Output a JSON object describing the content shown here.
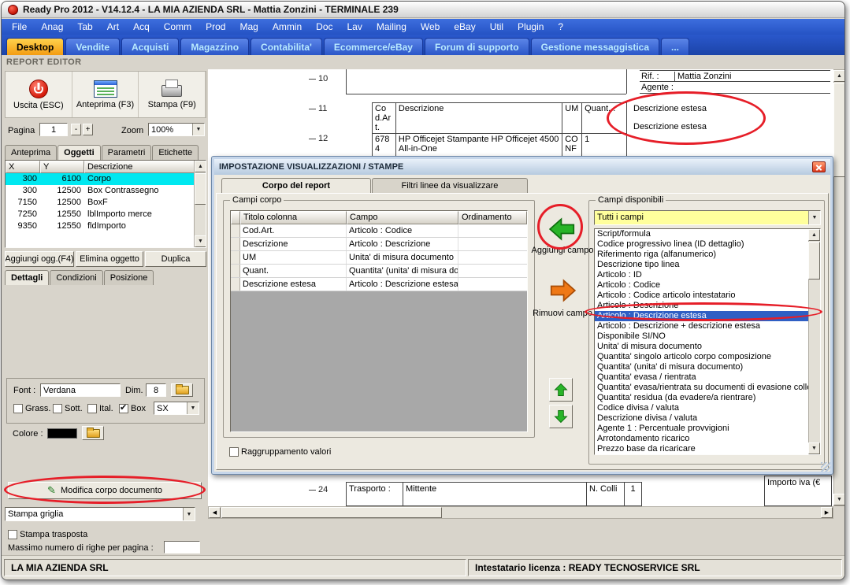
{
  "window": {
    "title": "Ready Pro 2012 - V14.12.4 - LA MIA AZIENDA SRL - Mattia Zonzini - TERMINALE 239"
  },
  "menu": {
    "items": [
      "File",
      "Anag",
      "Tab",
      "Art",
      "Acq",
      "Comm",
      "Prod",
      "Mag",
      "Ammin",
      "Doc",
      "Lav",
      "Mailing",
      "Web",
      "eBay",
      "Util",
      "Plugin",
      "?"
    ]
  },
  "main_tabs": [
    {
      "label": "Desktop",
      "active": true
    },
    {
      "label": "Vendite",
      "active": false
    },
    {
      "label": "Acquisti",
      "active": false
    },
    {
      "label": "Magazzino",
      "active": false
    },
    {
      "label": "Contabilita'",
      "active": false
    },
    {
      "label": "Ecommerce/eBay",
      "active": false
    },
    {
      "label": "Forum di supporto",
      "active": false
    },
    {
      "label": "Gestione messaggistica",
      "active": false
    },
    {
      "label": "...",
      "active": false
    }
  ],
  "report_editor": {
    "label": "REPORT EDITOR",
    "toolbar": {
      "uscita": "Uscita (ESC)",
      "anteprima": "Anteprima (F3)",
      "stampa": "Stampa (F9)"
    },
    "page": {
      "pagina_label": "Pagina",
      "value": "1",
      "minus": "-",
      "plus": "+",
      "zoom_label": "Zoom",
      "zoom_value": "100%"
    },
    "tabs": [
      "Anteprima",
      "Oggetti",
      "Parametri",
      "Etichette"
    ],
    "active_tab": "Oggetti",
    "object_table": {
      "headers": [
        "X",
        "Y",
        "Descrizione"
      ],
      "rows": [
        {
          "x": "300",
          "y": "6100",
          "desc": "Corpo",
          "selected": true
        },
        {
          "x": "300",
          "y": "12500",
          "desc": "Box Contrassegno",
          "selected": false
        },
        {
          "x": "7150",
          "y": "12500",
          "desc": "BoxF",
          "selected": false
        },
        {
          "x": "7250",
          "y": "12550",
          "desc": "lblImporto merce",
          "selected": false
        },
        {
          "x": "9350",
          "y": "12550",
          "desc": "fldImporto",
          "selected": false
        }
      ]
    },
    "object_buttons": [
      "Aggiungi ogg.(F4)",
      "Elimina oggetto",
      "Duplica"
    ],
    "detail_tabs": [
      "Dettagli",
      "Condizioni",
      "Posizione"
    ],
    "active_detail_tab": "Dettagli",
    "font": {
      "font_label": "Font :",
      "font_value": "Verdana",
      "dim_label": "Dim.",
      "dim_value": "8",
      "checkboxes": [
        {
          "label": "Grass.",
          "checked": false
        },
        {
          "label": "Sott.",
          "checked": false
        },
        {
          "label": "Ital.",
          "checked": false
        },
        {
          "label": "Box",
          "checked": true
        }
      ],
      "align_value": "SX",
      "colore_label": "Colore :"
    },
    "modifica_button": "Modifica corpo documento",
    "griglia_value": "Stampa griglia",
    "trasposta_label": "Stampa trasposta",
    "max_righe_label": "Massimo numero di righe per pagina :"
  },
  "preview": {
    "ruler": [
      "10",
      "11",
      "12"
    ],
    "ruler_bottom": "24",
    "rif_label": "Rif. :",
    "rif_value": "Mattia Zonzini",
    "agente_label": "Agente :",
    "table": {
      "headers": [
        "Cod.Art.",
        "Descrizione",
        "UM",
        "Quant..."
      ],
      "row": {
        "codice": "6784",
        "descrizione": "HP Officejet Stampante HP Officejet 4500 All-in-One",
        "um": "CONF",
        "quantita": "1"
      }
    },
    "descrizione_estesa": [
      "Descrizione estesa",
      "Descrizione estesa"
    ],
    "bottom": {
      "trasporto": "Trasporto :",
      "mittente": "Mittente",
      "colli_label": "N. Colli",
      "colli_value": "1",
      "importo": "Importo iva (€"
    }
  },
  "dialog": {
    "title": "IMPOSTAZIONE VISUALIZZAZIONI / STAMPE",
    "tabs": [
      "Corpo del report",
      "Filtri linee da visualizzare"
    ],
    "active_tab": "Corpo del report",
    "campi_corpo": {
      "label": "Campi corpo",
      "headers": [
        "Titolo colonna",
        "Campo",
        "Ordinamento"
      ],
      "rows": [
        {
          "titolo": "Cod.Art.",
          "campo": "Articolo : Codice",
          "ordinamento": ""
        },
        {
          "titolo": "Descrizione",
          "campo": "Articolo : Descrizione",
          "ordinamento": ""
        },
        {
          "titolo": "UM",
          "campo": "Unita' di misura documento",
          "ordinamento": ""
        },
        {
          "titolo": "Quant.",
          "campo": "Quantita' (unita' di misura docum...",
          "ordinamento": ""
        },
        {
          "titolo": "Descrizione estesa",
          "campo": "Articolo : Descrizione estesa",
          "ordinamento": ""
        }
      ]
    },
    "aggiungi_label": "Aggiungi campo",
    "rimuovi_label": "Rimuovi campo",
    "campi_disponibili": {
      "label": "Campi disponibili",
      "filter_value": "Tutti i campi",
      "items": [
        "Script/formula",
        "Codice progressivo linea (ID dettaglio)",
        "Riferimento riga (alfanumerico)",
        "Descrizione tipo linea",
        "Articolo : ID",
        "Articolo : Codice",
        "Articolo : Codice articolo intestatario",
        "Articolo : Descrizione",
        "Articolo : Descrizione estesa",
        "Articolo : Descrizione + descrizione estesa",
        "Disponibile SI/NO",
        "Unita' di misura documento",
        "Quantita' singolo articolo corpo composizione",
        "Quantita' (unita' di misura documento)",
        "Quantita' evasa / rientrata",
        "Quantita' evasa/rientrata su documenti di evasione colleg",
        "Quantita' residua (da evadere/a rientrare)",
        "Codice divisa / valuta",
        "Descrizione divisa / valuta",
        "Agente 1 : Percentuale provvigioni",
        "Arrotondamento ricarico",
        "Prezzo base da ricaricare"
      ],
      "selected": "Articolo : Descrizione estesa"
    },
    "raggruppamento_label": "Raggruppamento valori"
  },
  "statusbar": {
    "company": "LA MIA AZIENDA SRL",
    "license": "Intestatario licenza : READY TECNOSERVICE SRL"
  },
  "icons": {
    "pencil": "✎"
  }
}
